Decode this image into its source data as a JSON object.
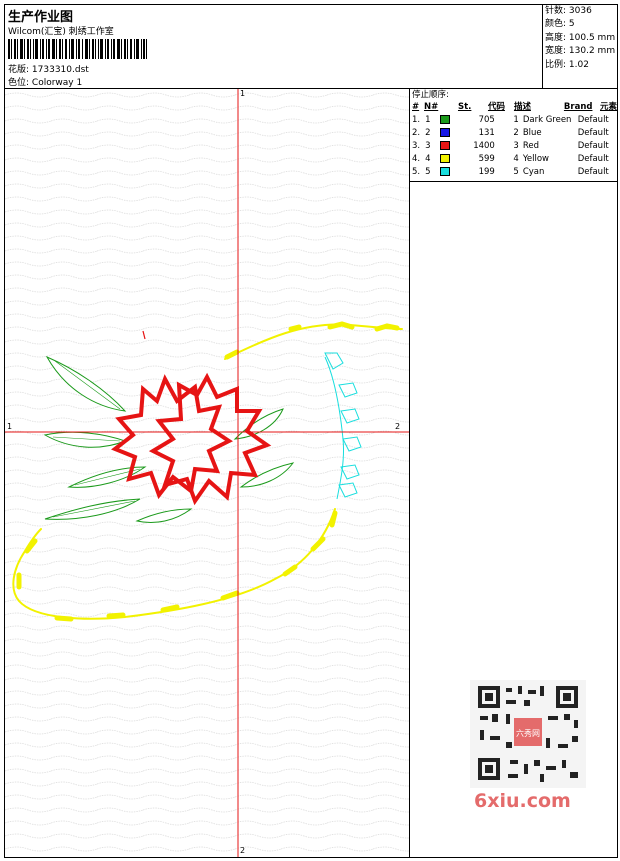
{
  "header": {
    "title": "生产作业图",
    "company": "Wilcom(汇宝) 刺绣工作室",
    "design_label": "花版:",
    "design_value": "1733310.dst",
    "colorway_label": "色位:",
    "colorway_value": "Colorway 1"
  },
  "specs": [
    {
      "label": "针数:",
      "value": "3036"
    },
    {
      "label": "颜色:",
      "value": "5"
    },
    {
      "label": "高度:",
      "value": "100.5 mm"
    },
    {
      "label": "宽度:",
      "value": "130.2 mm"
    },
    {
      "label": "比例:",
      "value": "1.02"
    }
  ],
  "stop_sequence": {
    "title": "停止顺序:",
    "columns": [
      "#",
      "N#",
      "St.",
      "代码",
      "描述",
      "Brand",
      "元素"
    ],
    "rows": [
      {
        "idx": "1.",
        "n": "1",
        "st": "705",
        "code": "1",
        "desc": "Dark Green",
        "brand": "Default",
        "color": "#1b9a1b"
      },
      {
        "idx": "2.",
        "n": "2",
        "st": "131",
        "code": "2",
        "desc": "Blue",
        "brand": "Default",
        "color": "#1616e6"
      },
      {
        "idx": "3.",
        "n": "3",
        "st": "1400",
        "code": "3",
        "desc": "Red",
        "brand": "Default",
        "color": "#e61414"
      },
      {
        "idx": "4.",
        "n": "4",
        "st": "599",
        "code": "4",
        "desc": "Yellow",
        "brand": "Default",
        "color": "#f2f200"
      },
      {
        "idx": "5.",
        "n": "5",
        "st": "199",
        "code": "5",
        "desc": "Cyan",
        "brand": "Default",
        "color": "#18dede"
      }
    ]
  },
  "axes": {
    "top": "1",
    "left": "1",
    "right": "2",
    "bottom": "2"
  },
  "watermark": {
    "site": "6xiu.com",
    "badge": "六秀网"
  }
}
